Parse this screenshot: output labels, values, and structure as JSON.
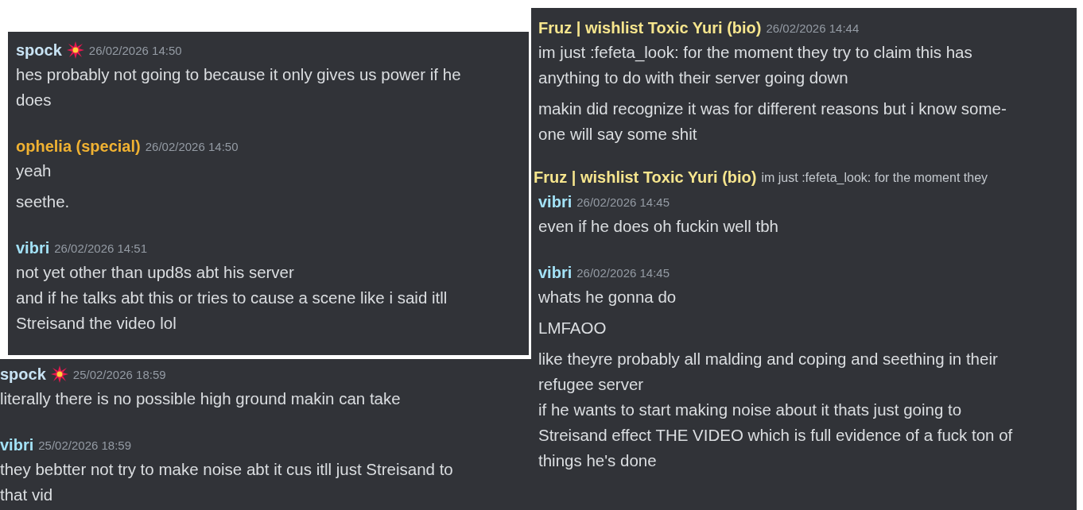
{
  "panels": [
    {
      "messages": [
        {
          "kind": "message",
          "author": "spock",
          "color": "#c8e3f4",
          "badge": true,
          "timestamp": "26/02/2026 14:50",
          "paragraphs": [
            "hes probably not going to because it only gives us power if he\ndoes"
          ]
        },
        {
          "kind": "message",
          "author": "ophelia (special)",
          "color": "#f0b232",
          "timestamp": "26/02/2026 14:50",
          "paragraphs": [
            "yeah",
            "seethe."
          ]
        },
        {
          "kind": "message",
          "author": "vibri",
          "color": "#a3e2f7",
          "timestamp": "26/02/2026 14:51",
          "paragraphs": [
            "not yet other than upd8s abt his server\nand if he talks abt this or tries to cause a scene like i said itll\nStreisand the video lol"
          ]
        }
      ]
    },
    {
      "messages": [
        {
          "kind": "message",
          "author": "Fruz | wishlist Toxic Yuri (bio)",
          "color": "#f6e58d",
          "timestamp": "26/02/2026 14:44",
          "paragraphs": [
            "im just :fefeta_look: for the moment they try to claim this has\nanything to do with their server going down",
            "makin did recognize it was for different reasons but i know some-\none will say some shit"
          ]
        },
        {
          "kind": "reply",
          "author": "Fruz | wishlist Toxic Yuri (bio)",
          "color": "#f6e58d",
          "preview": "im just :fefeta_look: for the moment they"
        },
        {
          "kind": "message",
          "author": "vibri",
          "color": "#a3e2f7",
          "timestamp": "26/02/2026 14:45",
          "paragraphs": [
            "even if he does oh fuckin well tbh"
          ]
        },
        {
          "kind": "message",
          "author": "vibri",
          "color": "#a3e2f7",
          "timestamp": "26/02/2026 14:45",
          "paragraphs": [
            "whats he gonna do",
            "LMFAOO",
            "like theyre probably all malding and coping and seething in their\nrefugee server\nif he wants to start making noise about it thats just going to\nStreisand effect THE VIDEO which is full evidence of a fuck ton of\nthings he's done"
          ]
        }
      ]
    },
    {
      "messages": [
        {
          "kind": "message",
          "author": "spock",
          "color": "#c8e3f4",
          "badge": true,
          "timestamp": "25/02/2026 18:59",
          "paragraphs": [
            "literally there is no possible high ground makin can take"
          ]
        },
        {
          "kind": "message",
          "author": "vibri",
          "color": "#a3e2f7",
          "timestamp": "25/02/2026 18:59",
          "paragraphs": [
            "they bebtter not try to make noise abt it cus itll just Streisand to\nthat vid"
          ]
        }
      ]
    }
  ]
}
